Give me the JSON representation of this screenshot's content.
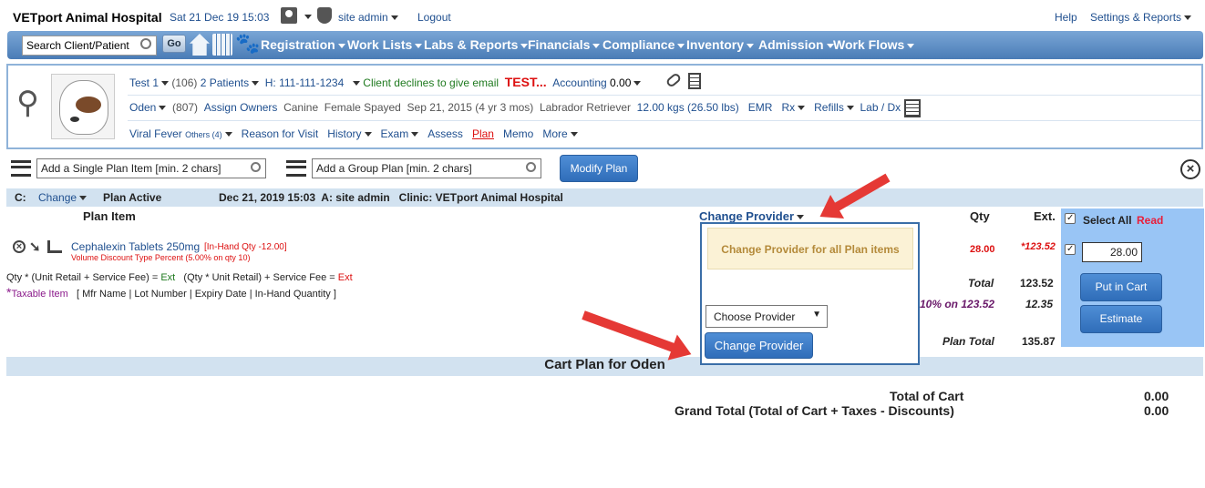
{
  "header": {
    "clinic": "VETport Animal Hospital",
    "datetime": "Sat 21 Dec 19 15:03",
    "user": "site admin",
    "logout": "Logout",
    "help": "Help",
    "settings": "Settings & Reports"
  },
  "nav": {
    "search_value": "Search Client/Patient",
    "go": "Go",
    "menus": [
      "Registration",
      "Work Lists",
      "Labs & Reports",
      "Financials",
      "Compliance",
      "Inventory",
      "Admission",
      "Work Flows"
    ]
  },
  "patient": {
    "row1": {
      "client": "Test 1",
      "client_id": "(106)",
      "patients": "2  Patients",
      "phone": "H: 111-111-1234",
      "email_note": "Client declines to give email",
      "flag": "TEST...",
      "accounting_label": "Accounting",
      "accounting_val": "0.00"
    },
    "row2": {
      "name": "Oden",
      "id": "(807)",
      "assign": "Assign Owners",
      "species": "Canine",
      "sex": "Female Spayed",
      "dob": "Sep 21, 2015 (4 yr 3 mos)",
      "breed": "Labrador Retriever",
      "weight": "12.00 kgs (26.50 lbs)",
      "emr": "EMR",
      "rx": "Rx",
      "refills": "Refills",
      "labdx": "Lab / Dx"
    },
    "row3": {
      "problem": "Viral Fever",
      "others": "Others (4)",
      "reason": "Reason for Visit",
      "history": "History",
      "exam": "Exam",
      "assess": "Assess",
      "plan": "Plan",
      "memo": "Memo",
      "more": "More"
    }
  },
  "toolbar": {
    "single_plan": "Add a Single Plan Item [min. 2 chars]",
    "group_plan": "Add a Group Plan [min. 2 chars]",
    "modify": "Modify Plan"
  },
  "status": {
    "c_label": "C:",
    "change": "Change",
    "plan_active": "Plan Active",
    "date_line": "Dec 21, 2019 15:03  A: site admin   Clinic: VETport Animal Hospital"
  },
  "table": {
    "plan_item": "Plan Item",
    "change_provider": "Change Provider",
    "qty": "Qty",
    "ext": "Ext.",
    "select_all": "Select All",
    "read": "Read"
  },
  "item": {
    "name": "Cephalexin Tablets 250mg",
    "inhand": "[In-Hand Qty -12.00]",
    "discount": "Volume Discount Type Percent (5.00% on qty 10)",
    "qty": "28.00",
    "ext": "*123.52",
    "qty_input": "28.00"
  },
  "legend": {
    "line1a": "Qty * (Unit Retail + Service Fee) =",
    "line1b": "Ext",
    "line1c": "(Qty * Unit Retail) + Service Fee =",
    "line1d": "Ext",
    "taxable": "Taxable Item",
    "fields": "[ Mfr Name | Lot Number | Expiry Date | In-Hand Quantity ]"
  },
  "totals": {
    "total_label": "Total",
    "total": "123.52",
    "tax_label": "10% on 123.52",
    "tax": "12.35",
    "plan_total_label": "Plan Total",
    "plan_total": "135.87"
  },
  "actions": {
    "put_in_cart": "Put in Cart",
    "estimate": "Estimate"
  },
  "dropdown": {
    "change_all": "Change Provider for all Plan items",
    "choose": "Choose Provider",
    "button": "Change Provider"
  },
  "cart": {
    "title": "Cart Plan for Oden",
    "total_label": "Total of Cart",
    "total": "0.00",
    "grand_label": "Grand Total (Total of Cart + Taxes - Discounts)",
    "grand": "0.00"
  }
}
